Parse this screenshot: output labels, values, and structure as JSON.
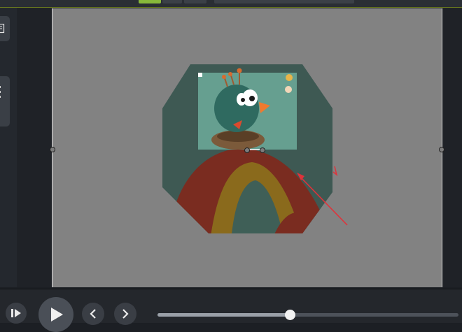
{
  "window": {
    "accent_color": "#9bd03a",
    "canvas_color": "#828282"
  },
  "left_rail": {
    "buttons": [
      "panel-toggle-icon",
      "grip-icon"
    ]
  },
  "canvas": {
    "media": {
      "description_icon": "bird-nest-sticker",
      "shape": "octagon-mask"
    },
    "annotation": "red-arrow"
  },
  "playback": {
    "controls": [
      "step-frame-icon",
      "play-icon",
      "previous-icon",
      "next-icon"
    ],
    "progress": 0.44
  }
}
